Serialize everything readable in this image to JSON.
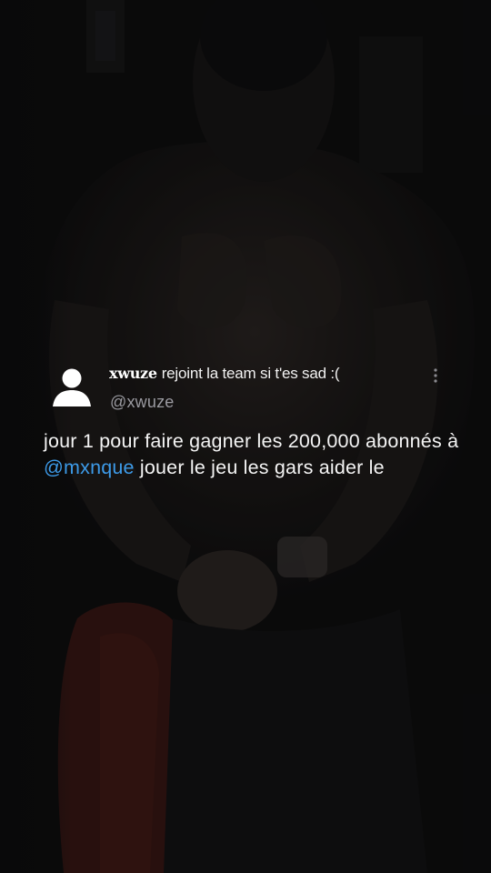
{
  "post": {
    "avatar_icon": "default-user-avatar-icon",
    "display_name": "xwuze",
    "bio": "rejoint la team si t'es sad :(",
    "handle": "@xwuze",
    "menu_icon": "more-vertical-icon",
    "text_before": "jour 1 pour faire gagner les 200,000 abonnés à ",
    "mention": "@mxnque",
    "text_after": " jouer le jeu les gars aider le"
  },
  "colors": {
    "background": "#0b0b0c",
    "mention": "#3d9be9",
    "handle": "#9a9aa0",
    "text": "#f4f4f4"
  }
}
